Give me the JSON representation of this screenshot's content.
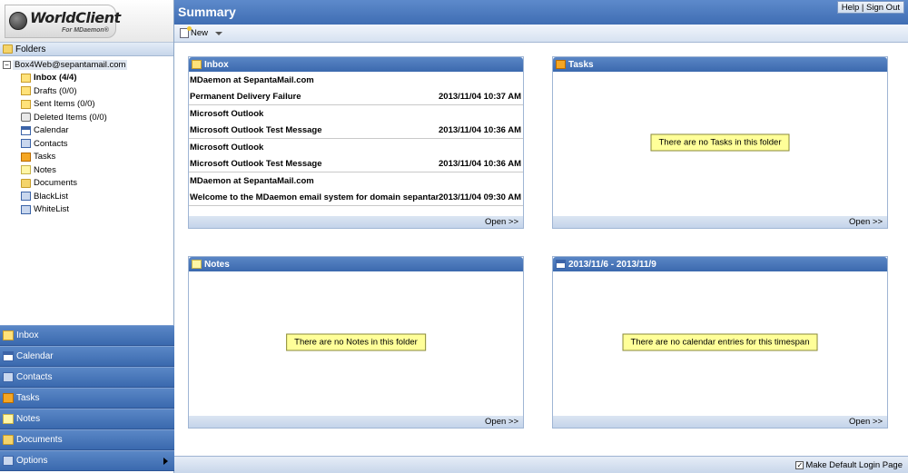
{
  "app": {
    "logo_text": "WorldClient",
    "logo_subtext": "For MDaemon®"
  },
  "header": {
    "title": "Summary",
    "help": "Help",
    "separator": " | ",
    "signout": "Sign Out"
  },
  "toolbar": {
    "new_label": "New"
  },
  "sidebar": {
    "folders_label": "Folders",
    "account": "Box4Web@sepantamail.com",
    "items": [
      {
        "label": "Inbox (4/4)",
        "icon": "folder-envelope-icon",
        "bold": true
      },
      {
        "label": "Drafts (0/0)",
        "icon": "drafts-folder-icon"
      },
      {
        "label": "Sent Items (0/0)",
        "icon": "sent-folder-icon"
      },
      {
        "label": "Deleted Items (0/0)",
        "icon": "trash-icon"
      },
      {
        "label": "Calendar",
        "icon": "calendar-icon"
      },
      {
        "label": "Contacts",
        "icon": "contacts-icon"
      },
      {
        "label": "Tasks",
        "icon": "tasks-icon"
      },
      {
        "label": "Notes",
        "icon": "notes-icon"
      },
      {
        "label": "Documents",
        "icon": "documents-folder-icon"
      },
      {
        "label": "BlackList",
        "icon": "list-icon"
      },
      {
        "label": "WhiteList",
        "icon": "list-icon"
      }
    ]
  },
  "nav": {
    "items": [
      {
        "label": "Inbox",
        "icon": "inbox-icon"
      },
      {
        "label": "Calendar",
        "icon": "calendar-icon"
      },
      {
        "label": "Contacts",
        "icon": "contacts-icon"
      },
      {
        "label": "Tasks",
        "icon": "tasks-icon"
      },
      {
        "label": "Notes",
        "icon": "notes-icon"
      },
      {
        "label": "Documents",
        "icon": "documents-icon"
      },
      {
        "label": "Options",
        "icon": "options-icon"
      }
    ]
  },
  "panels": {
    "inbox": {
      "title": "Inbox",
      "open": "Open >>",
      "messages": [
        {
          "from": "MDaemon at SepantaMail.com",
          "subject": "Permanent Delivery Failure",
          "date": "2013/11/04 10:37 AM"
        },
        {
          "from": "Microsoft Outlook",
          "subject": "Microsoft Outlook Test Message",
          "date": "2013/11/04 10:36 AM"
        },
        {
          "from": "Microsoft Outlook",
          "subject": "Microsoft Outlook Test Message",
          "date": "2013/11/04 10:36 AM"
        },
        {
          "from": "MDaemon at SepantaMail.com",
          "subject": "Welcome to the MDaemon email system for domain sepantan",
          "date": "2013/11/04 09:30 AM"
        }
      ]
    },
    "tasks": {
      "title": "Tasks",
      "empty": "There are no Tasks in this folder",
      "open": "Open >>"
    },
    "notes": {
      "title": "Notes",
      "empty": "There are no Notes in this folder",
      "open": "Open >>"
    },
    "calendar": {
      "title": "2013/11/6 - 2013/11/9",
      "empty": "There are no calendar entries for this timespan",
      "open": "Open >>"
    }
  },
  "status": {
    "make_default_label": "Make Default Login Page",
    "make_default_checked": true
  },
  "colors": {
    "header_blue": "#3f6db3",
    "nav_blue": "#3a69ae",
    "empty_msg_bg": "#ffff99"
  }
}
